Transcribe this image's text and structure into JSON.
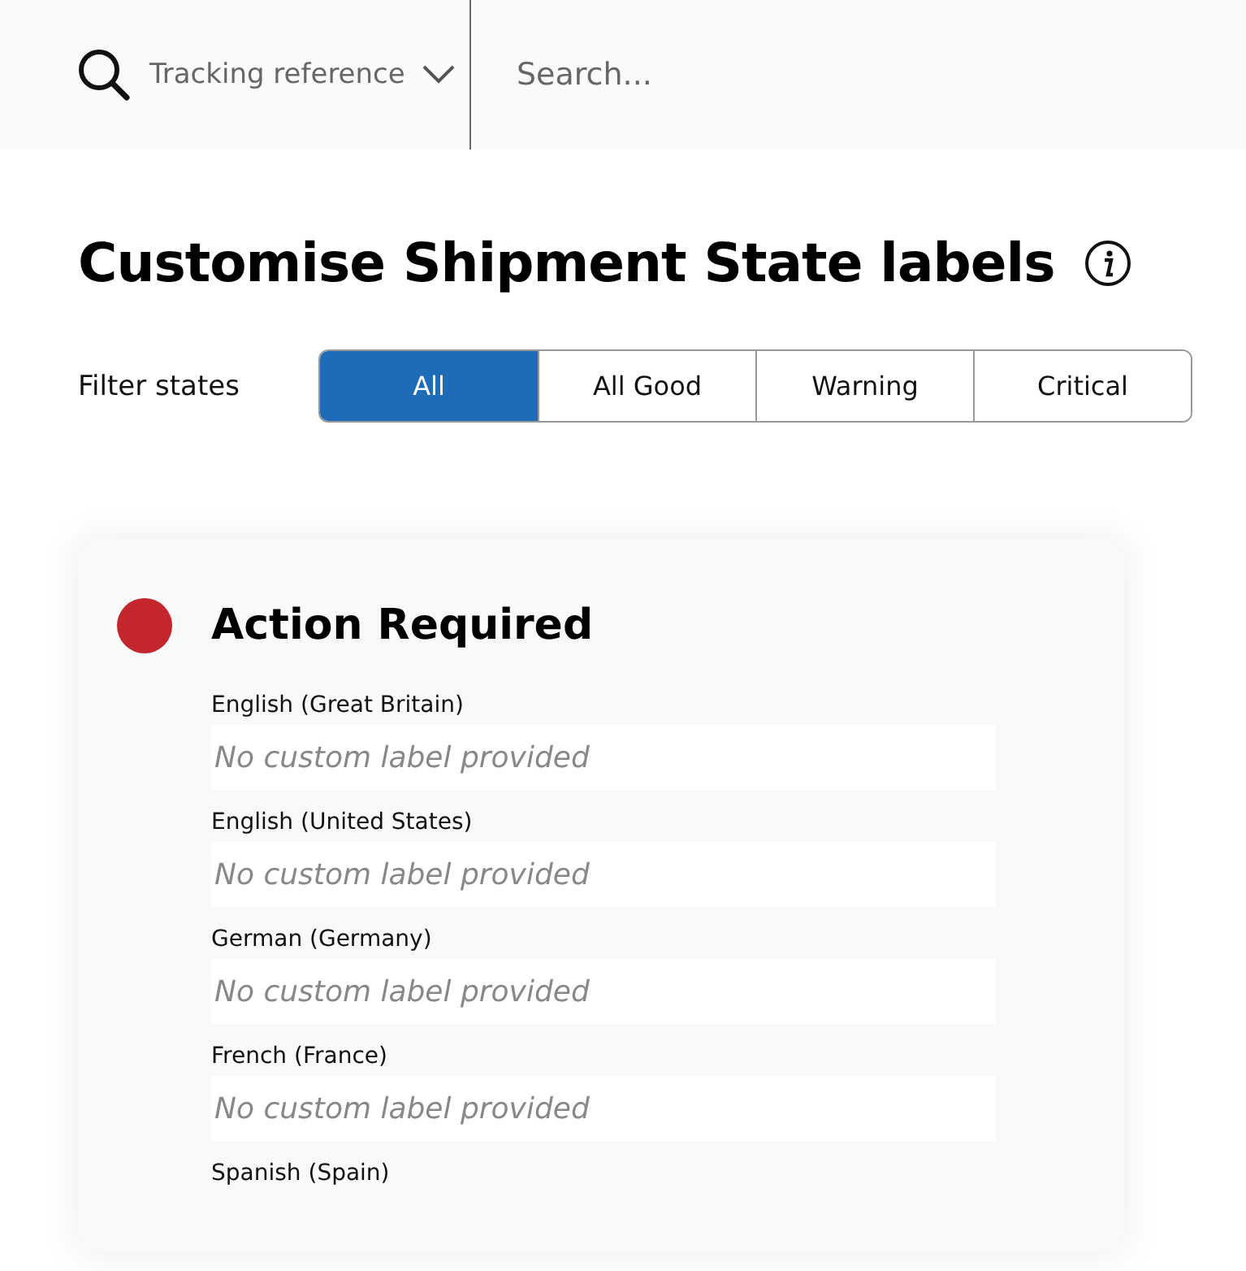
{
  "search_bar": {
    "search_type": "Tracking reference",
    "placeholder": "Search..."
  },
  "page_title": "Customise Shipment State labels",
  "filter": {
    "label": "Filter states",
    "options": [
      {
        "label": "All",
        "selected": true
      },
      {
        "label": "All Good",
        "selected": false
      },
      {
        "label": "Warning",
        "selected": false
      },
      {
        "label": "Critical",
        "selected": false
      }
    ]
  },
  "state_card": {
    "title": "Action Required",
    "color": "#c4262e",
    "labels": [
      {
        "language": "English (Great Britain)",
        "placeholder": "No custom label provided"
      },
      {
        "language": "English (United States)",
        "placeholder": "No custom label provided"
      },
      {
        "language": "German (Germany)",
        "placeholder": "No custom label provided"
      },
      {
        "language": "French (France)",
        "placeholder": "No custom label provided"
      },
      {
        "language": "Spanish (Spain)"
      }
    ]
  }
}
